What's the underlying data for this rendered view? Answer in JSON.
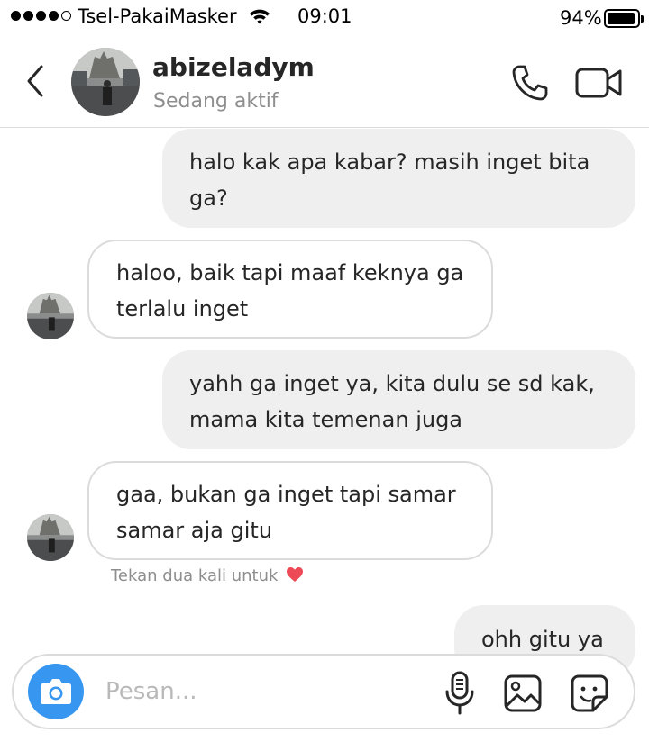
{
  "status_bar": {
    "carrier": "Tsel-PakaiMasker",
    "time": "09:01",
    "battery_percent": "94%",
    "battery_level": 0.94,
    "signal_bars": 4,
    "signal_total": 5
  },
  "header": {
    "username": "abizeladym",
    "status": "Sedang aktif"
  },
  "messages": [
    {
      "from": "me",
      "text": "halo kak apa kabar? masih inget bita ga?"
    },
    {
      "from": "them",
      "text": "haloo, baik tapi maaf keknya ga terlalu inget"
    },
    {
      "from": "me",
      "text": "yahh ga inget ya, kita dulu se sd kak, mama kita temenan juga"
    },
    {
      "from": "them",
      "text": "gaa, bukan ga inget tapi samar samar aja gitu"
    },
    {
      "from": "me",
      "text": "ohh gitu ya"
    }
  ],
  "hint": {
    "text": "Tekan dua kali untuk",
    "emoji": "❤️"
  },
  "composer": {
    "placeholder": "Pesan..."
  },
  "colors": {
    "accent": "#3797f0",
    "sent_bubble": "#efefef",
    "border": "#dbdbdb",
    "muted_text": "#8e8e8e",
    "heart": "#ed4956"
  }
}
